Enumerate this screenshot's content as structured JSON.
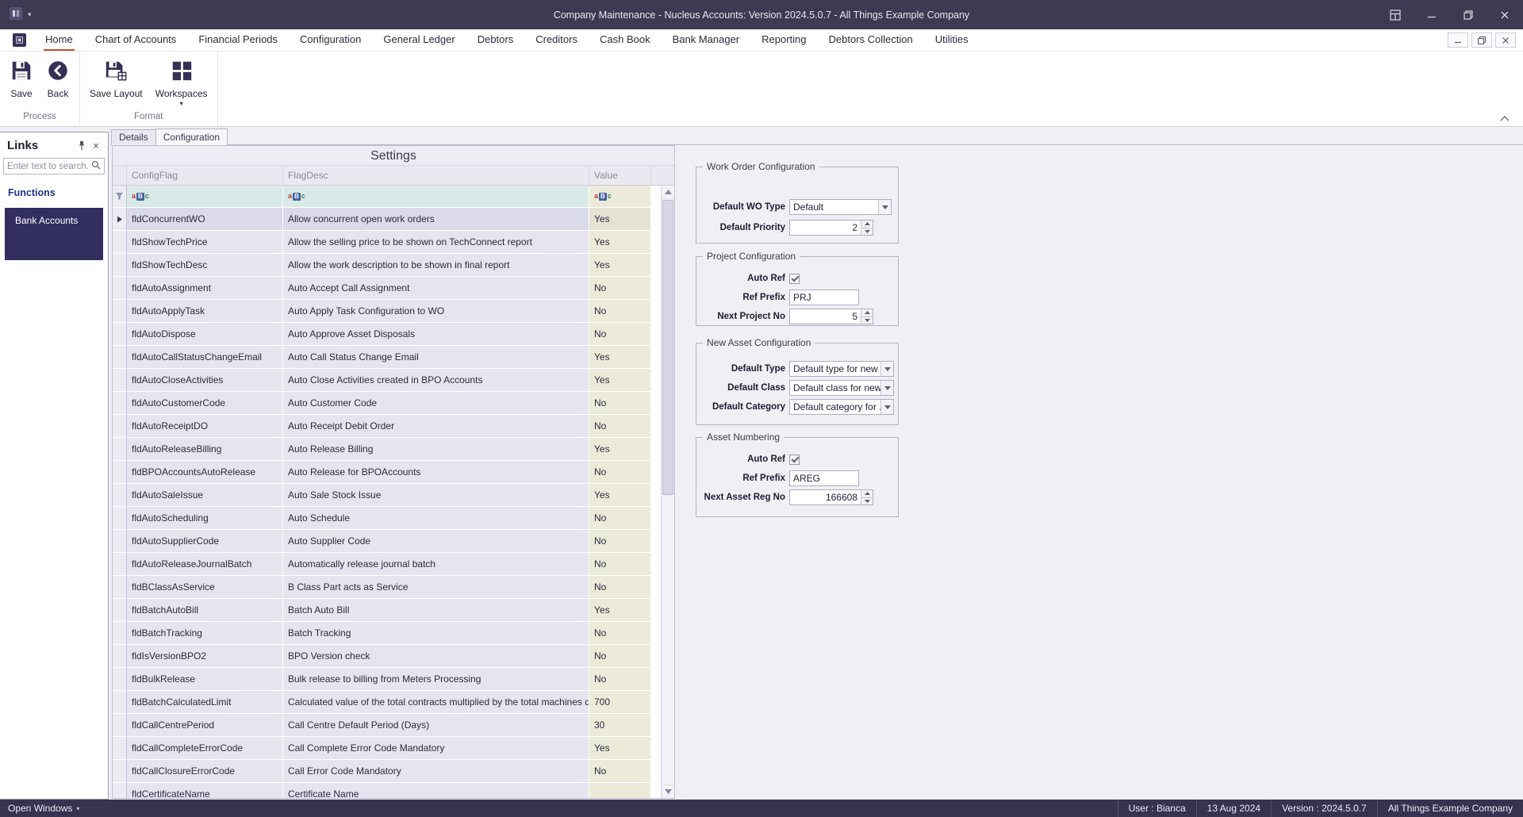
{
  "colors": {
    "titlebar_bg": "#3e3a52",
    "statusbar_bg": "#373250",
    "accent_underline": "#c0512f",
    "selection_bg": "#322e5f",
    "functions_label_color": "#24338b",
    "value_cell_bg": "#ecebda",
    "filter_cell_bg": "#d9e9e8",
    "row_cell_bg": "#e5e4ef"
  },
  "window": {
    "title": "Company Maintenance - Nucleus Accounts: Version 2024.5.0.7 - All Things Example Company"
  },
  "ribbon": {
    "active_tab": "Home",
    "tabs": [
      "Home",
      "Chart of Accounts",
      "Financial Periods",
      "Configuration",
      "General Ledger",
      "Debtors",
      "Creditors",
      "Cash Book",
      "Bank Manager",
      "Reporting",
      "Debtors Collection",
      "Utilities"
    ],
    "groups": [
      {
        "label": "Process",
        "buttons": [
          {
            "label": "Save",
            "icon": "save"
          },
          {
            "label": "Back",
            "icon": "back"
          }
        ]
      },
      {
        "label": "Format",
        "buttons": [
          {
            "label": "Save Layout",
            "icon": "save-layout"
          },
          {
            "label": "Workspaces",
            "icon": "workspaces",
            "dropdown": true
          }
        ]
      }
    ]
  },
  "links_panel": {
    "title": "Links",
    "search_placeholder": "Enter text to search...",
    "section_label": "Functions",
    "items": [
      {
        "label": "Bank Accounts",
        "selected": true
      }
    ]
  },
  "doc_tabs": [
    {
      "label": "Details",
      "active": false
    },
    {
      "label": "Configuration",
      "active": true
    }
  ],
  "grid": {
    "title": "Settings",
    "filter_icon_text": "aBc",
    "columns": [
      {
        "key": "flag",
        "label": "ConfigFlag"
      },
      {
        "key": "desc",
        "label": "FlagDesc"
      },
      {
        "key": "value",
        "label": "Value"
      }
    ],
    "rows": [
      {
        "flag": "fldConcurrentWO",
        "desc": "Allow concurrent open work orders",
        "value": "Yes",
        "current": true
      },
      {
        "flag": "fldShowTechPrice",
        "desc": "Allow the selling price to be shown on TechConnect report",
        "value": "Yes"
      },
      {
        "flag": "fldShowTechDesc",
        "desc": "Allow the work description to be shown in final report",
        "value": "Yes"
      },
      {
        "flag": "fldAutoAssignment",
        "desc": "Auto Accept Call Assignment",
        "value": "No"
      },
      {
        "flag": "fldAutoApplyTask",
        "desc": "Auto Apply Task Configuration to WO",
        "value": "No"
      },
      {
        "flag": "fldAutoDispose",
        "desc": "Auto Approve Asset Disposals",
        "value": "No"
      },
      {
        "flag": "fldAutoCallStatusChangeEmail",
        "desc": "Auto Call Status Change Email",
        "value": "Yes"
      },
      {
        "flag": "fldAutoCloseActivities",
        "desc": "Auto Close Activities created in BPO Accounts",
        "value": "Yes"
      },
      {
        "flag": "fldAutoCustomerCode",
        "desc": "Auto Customer Code",
        "value": "No"
      },
      {
        "flag": "fldAutoReceiptDO",
        "desc": "Auto Receipt Debit Order",
        "value": "No"
      },
      {
        "flag": "fldAutoReleaseBilling",
        "desc": "Auto Release Billing",
        "value": "Yes"
      },
      {
        "flag": "fldBPOAccountsAutoRelease",
        "desc": "Auto Release for BPOAccounts",
        "value": "No"
      },
      {
        "flag": "fldAutoSaleIssue",
        "desc": "Auto Sale Stock Issue",
        "value": "Yes"
      },
      {
        "flag": "fldAutoScheduling",
        "desc": "Auto Schedule",
        "value": "No"
      },
      {
        "flag": "fldAutoSupplierCode",
        "desc": "Auto Supplier Code",
        "value": "No"
      },
      {
        "flag": "fldAutoReleaseJournalBatch",
        "desc": "Automatically release journal batch",
        "value": "No"
      },
      {
        "flag": "fldBClassAsService",
        "desc": "B Class Part acts as Service",
        "value": "No"
      },
      {
        "flag": "fldBatchAutoBill",
        "desc": "Batch Auto Bill",
        "value": "Yes"
      },
      {
        "flag": "fldBatchTracking",
        "desc": "Batch Tracking",
        "value": "No"
      },
      {
        "flag": "fldIsVersionBPO2",
        "desc": "BPO Version check",
        "value": "No"
      },
      {
        "flag": "fldBulkRelease",
        "desc": "Bulk release to billing from Meters Processing",
        "value": "No"
      },
      {
        "flag": "fldBatchCalculatedLimit",
        "desc": "Calculated value of the total contracts multiplied by the total machines divi...",
        "value": "700"
      },
      {
        "flag": "fldCallCentrePeriod",
        "desc": "Call Centre Default Period (Days)",
        "value": "30"
      },
      {
        "flag": "fldCallCompleteErrorCode",
        "desc": "Call Complete Error Code Mandatory",
        "value": "Yes"
      },
      {
        "flag": "fldCallClosureErrorCode",
        "desc": "Call Error Code Mandatory",
        "value": "No"
      },
      {
        "flag": "fldCertificateName",
        "desc": "Certificate Name",
        "value": ""
      }
    ]
  },
  "panels": [
    {
      "title": "Work Order Configuration",
      "fields": [
        {
          "label": "Default WO Type",
          "type": "combo",
          "value": "Default"
        },
        {
          "label": "Default Priority",
          "type": "spin",
          "value": "2"
        }
      ]
    },
    {
      "title": "Project Configuration",
      "fields": [
        {
          "label": "Auto Ref",
          "type": "checkbox",
          "checked": true
        },
        {
          "label": "Ref Prefix",
          "type": "text",
          "value": "PRJ"
        },
        {
          "label": "Next Project No",
          "type": "spin",
          "value": "5"
        }
      ]
    },
    {
      "title": "New Asset Configuration",
      "fields": [
        {
          "label": "Default Type",
          "type": "combo",
          "value": "Default type for new ..."
        },
        {
          "label": "Default Class",
          "type": "combo",
          "value": "Default class for new ..."
        },
        {
          "label": "Default Category",
          "type": "combo",
          "value": "Default category for ..."
        }
      ]
    },
    {
      "title": "Asset Numbering",
      "fields": [
        {
          "label": "Auto Ref",
          "type": "checkbox",
          "checked": true
        },
        {
          "label": "Ref Prefix",
          "type": "text",
          "value": "AREG"
        },
        {
          "label": "Next Asset Reg No",
          "type": "spin",
          "value": "166608"
        }
      ]
    }
  ],
  "statusbar": {
    "left_label": "Open Windows",
    "items": [
      "User : Bianca",
      "13 Aug 2024",
      "Version : 2024.5.0.7",
      "All Things Example Company"
    ]
  }
}
